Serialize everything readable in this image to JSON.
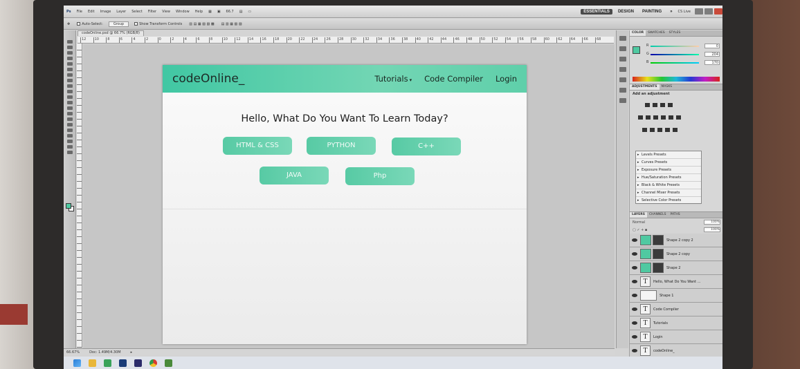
{
  "photoshop": {
    "menu": [
      "File",
      "Edit",
      "Image",
      "Layer",
      "Select",
      "Filter",
      "View",
      "Window",
      "Help"
    ],
    "zoom_value": "66.7",
    "workspaces": [
      "ESSENTIALS",
      "DESIGN",
      "PAINTING"
    ],
    "more_label": "»",
    "cs_live": "CS Live",
    "options": {
      "auto_select_label": "Auto-Select:",
      "auto_select_value": "Group",
      "show_transform_label": "Show Transform Controls"
    },
    "doc_tab": "codeOnline.psd @ 66.7% (RGB/8)",
    "ruler_marks": [
      "12",
      "10",
      "8",
      "6",
      "4",
      "2",
      "0",
      "2",
      "4",
      "6",
      "8",
      "10",
      "12",
      "14",
      "16",
      "18",
      "20",
      "22",
      "24",
      "26",
      "28",
      "30",
      "32",
      "34",
      "36",
      "38",
      "40",
      "42",
      "44",
      "46",
      "48",
      "50",
      "52",
      "54",
      "56",
      "58",
      "60",
      "62",
      "64",
      "66",
      "68"
    ],
    "status": {
      "zoom": "66.67%",
      "doc": "Doc: 1.49M/4.30M"
    },
    "panels": {
      "color_tabs": [
        "COLOR",
        "SWATCHES",
        "STYLES"
      ],
      "color_values": {
        "r": "0",
        "g": "204",
        "b": "170"
      },
      "adjust_tabs": [
        "ADJUSTMENTS",
        "MASKS"
      ],
      "adjust_title": "Add an adjustment",
      "presets": [
        "Levels Presets",
        "Curves Presets",
        "Exposure Presets",
        "Hue/Saturation Presets",
        "Black & White Presets",
        "Channel Mixer Presets",
        "Selective Color Presets"
      ],
      "layers_tabs": [
        "LAYERS",
        "CHANNELS",
        "PATHS"
      ],
      "blend_mode": "Normal",
      "opacity_value": "100%",
      "fill_value": "100%",
      "layers": [
        {
          "name": "Shape 2 copy 2",
          "kind": "shape"
        },
        {
          "name": "Shape 2 copy",
          "kind": "shape"
        },
        {
          "name": "Shape 2",
          "kind": "shape"
        },
        {
          "name": "Hello, What Do You Want ...",
          "kind": "text"
        },
        {
          "name": "Shape 1",
          "kind": "blank"
        },
        {
          "name": "Code Compiler",
          "kind": "text"
        },
        {
          "name": "Tutorials",
          "kind": "text"
        },
        {
          "name": "Login",
          "kind": "text"
        },
        {
          "name": "codeOnline_",
          "kind": "text"
        }
      ]
    }
  },
  "site": {
    "logo": "codeOnline_",
    "nav": {
      "tutorials": "Tutorials",
      "tutorials_caret": "▾",
      "compiler": "Code Compiler",
      "login": "Login"
    },
    "heading": "Hello, What Do You Want To Learn Today?",
    "courses": [
      "HTML & CSS",
      "PYTHON",
      "C++",
      "JAVA",
      "Php"
    ]
  },
  "colors": {
    "accent": "#4fc9a1",
    "nav_gradient_start": "#41c7a3",
    "nav_gradient_end": "#73d6b4"
  }
}
